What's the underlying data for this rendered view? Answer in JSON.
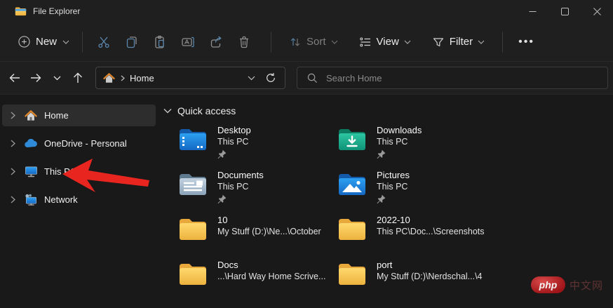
{
  "window": {
    "title": "File Explorer"
  },
  "window_controls": {
    "minimize": "minimize",
    "maximize": "maximize",
    "close": "close"
  },
  "toolbar": {
    "new_label": "New",
    "sort_label": "Sort",
    "view_label": "View",
    "filter_label": "Filter",
    "more_label": "...",
    "icon_names": [
      "cut-icon",
      "copy-icon",
      "paste-icon",
      "rename-icon",
      "share-icon",
      "delete-icon"
    ]
  },
  "navbar": {
    "breadcrumb_root": "Home",
    "search_placeholder": "Search Home"
  },
  "sidebar": {
    "items": [
      {
        "label": "Home",
        "selected": true
      },
      {
        "label": "OneDrive - Personal",
        "selected": false
      },
      {
        "label": "This PC",
        "selected": false
      },
      {
        "label": "Network",
        "selected": false
      }
    ]
  },
  "main": {
    "section_title": "Quick access",
    "items": [
      {
        "name": "Desktop",
        "location": "This PC",
        "pinned": true,
        "folder": "desktop"
      },
      {
        "name": "Downloads",
        "location": "This PC",
        "pinned": true,
        "folder": "downloads"
      },
      {
        "name": "Documents",
        "location": "This PC",
        "pinned": true,
        "folder": "documents"
      },
      {
        "name": "Pictures",
        "location": "This PC",
        "pinned": true,
        "folder": "pictures"
      },
      {
        "name": "10",
        "location": "My Stuff (D:)\\Ne...\\October",
        "pinned": false,
        "folder": "generic"
      },
      {
        "name": "2022-10",
        "location": "This PC\\Doc...\\Screenshots",
        "pinned": false,
        "folder": "generic"
      },
      {
        "name": "Docs",
        "location": "...\\Hard Way Home Scrive...",
        "pinned": false,
        "folder": "generic"
      },
      {
        "name": "port",
        "location": "My Stuff (D:)\\Nerdschal...\\4",
        "pinned": false,
        "folder": "generic"
      }
    ]
  },
  "annotation": {
    "type": "red-arrow",
    "points_to": "This PC sidebar item"
  },
  "watermark": {
    "logo": "php",
    "text": "中文网"
  },
  "colors": {
    "chrome_bg": "#1f1f1f",
    "content_bg": "#191919",
    "selected_bg": "#2d2d2d",
    "accent_blue": "#5b87ad",
    "arrow_red": "#e8251f",
    "folder_yellow": "#f7c94f",
    "watermark_red": "#a31b1f"
  }
}
